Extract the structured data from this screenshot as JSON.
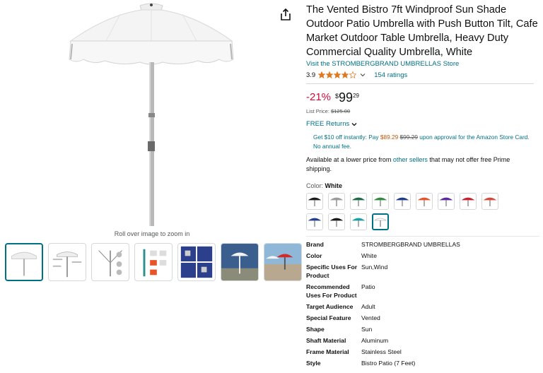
{
  "product": {
    "title": "The Vented Bistro 7ft Windproof Sun Shade Outdoor Patio Umbrella with Push Button Tilt, Cafe Market Outdoor Table Umbrella, Heavy Duty Commercial Quality Umbrella, White",
    "store_link": "Visit the STROMBERGBRAND UMBRELLAS Store",
    "rating": "3.9",
    "stars_fraction": 0.78,
    "ratings_count": "154 ratings"
  },
  "price": {
    "discount": "-21%",
    "symbol": "$",
    "whole": "99",
    "fraction": "29",
    "list_label": "List Price:",
    "list_value": "$125.00"
  },
  "returns": "FREE Returns",
  "promo": {
    "prefix": "Get $10 off instantly: Pay ",
    "new_price": "$89.29",
    "old_price": "$99.29",
    "suffix": " upon approval for the Amazon Store Card. No annual fee."
  },
  "lower_price": {
    "prefix": "Available at a lower price from ",
    "link": "other sellers",
    "suffix": " that may not offer free Prime shipping."
  },
  "color": {
    "label": "Color:",
    "value": "White",
    "swatches": [
      "#1a1a1a",
      "#9b9b9b",
      "#1f6b48",
      "#2e8b3d",
      "#1e3a8a",
      "#e8542a",
      "#5b2a9e",
      "#c8202f",
      "#d44a3a",
      "#23408e",
      "#1a1a1a",
      "#1aa3a3",
      "#ffffff"
    ],
    "selected_index": 12
  },
  "zoom_hint": "Roll over image to zoom in",
  "specs": [
    {
      "k": "Brand",
      "v": "STROMBERGBRAND UMBRELLAS"
    },
    {
      "k": "Color",
      "v": "White"
    },
    {
      "k": "Specific Uses For Product",
      "v": "Sun,Wind"
    },
    {
      "k": "Recommended Uses For Product",
      "v": "Patio"
    },
    {
      "k": "Target Audience",
      "v": "Adult"
    },
    {
      "k": "Special Feature",
      "v": "Vented"
    },
    {
      "k": "Shape",
      "v": "Sun"
    },
    {
      "k": "Shaft Material",
      "v": "Aluminum"
    },
    {
      "k": "Frame Material",
      "v": "Stainless Steel"
    },
    {
      "k": "Style",
      "v": "Bistro Patio (7 Feet)"
    }
  ]
}
